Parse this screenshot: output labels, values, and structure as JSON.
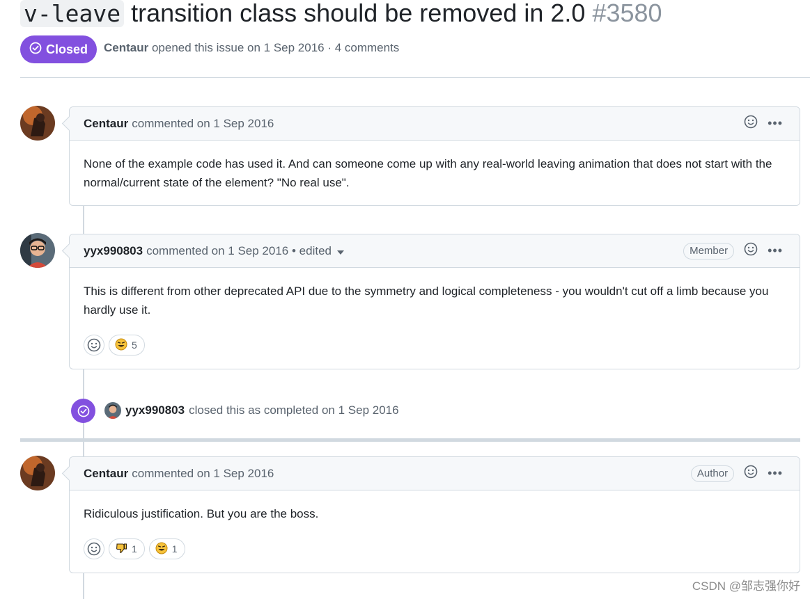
{
  "issue": {
    "title_code": "v-leave",
    "title_rest": " transition class should be removed in 2.0 ",
    "number": "#3580",
    "state": "Closed",
    "author": "Centaur",
    "meta_text": "opened this issue on 1 Sep 2016 · 4 comments",
    "accent_color": "#8250df"
  },
  "comments": [
    {
      "author": "Centaur",
      "action": "commented on 1 Sep 2016",
      "edited": "",
      "role": "",
      "body": "None of the example code has used it. And can someone come up with any real-world leaving animation that does not start with the normal/current state of the element? \"No real use\".",
      "reactions": []
    },
    {
      "author": "yyx990803",
      "action": "commented on 1 Sep 2016",
      "edited": "• edited",
      "role": "Member",
      "body": "This is different from other deprecated API due to the symmetry and logical completeness - you wouldn't cut off a limb because you hardly use it.",
      "reactions": [
        {
          "icon": "grinning-emoji-icon",
          "count": "5"
        }
      ]
    },
    {
      "author": "Centaur",
      "action": "commented on 1 Sep 2016",
      "edited": "",
      "role": "Author",
      "body": "Ridiculous justification. But you are the boss.",
      "reactions": [
        {
          "icon": "thumbs-down-emoji-icon",
          "count": "1"
        },
        {
          "icon": "grinning-emoji-icon",
          "count": "1"
        }
      ]
    }
  ],
  "event": {
    "actor": "yyx990803",
    "text": "closed this as completed on 1 Sep 2016"
  },
  "watermark": "CSDN @邹志强你好"
}
